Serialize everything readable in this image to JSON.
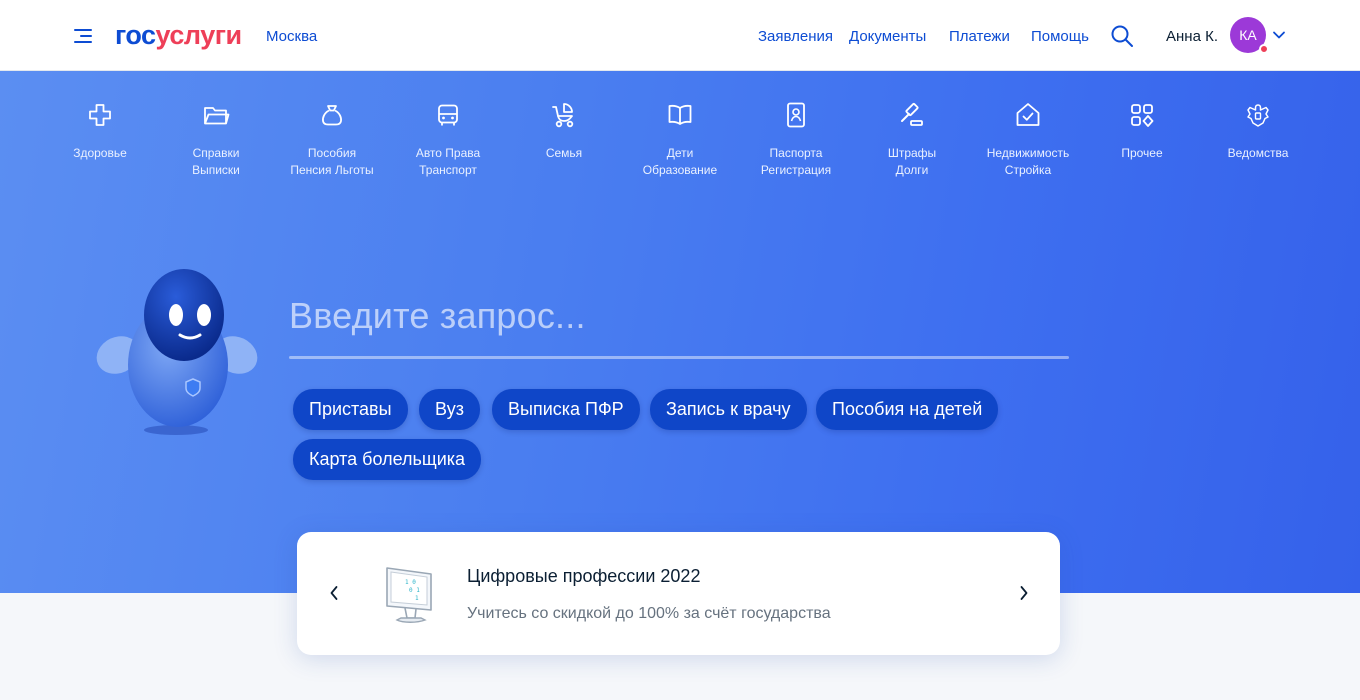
{
  "header": {
    "logo_part1": "гос",
    "logo_part2": "услуги",
    "city": "Москва",
    "nav": [
      "Заявления",
      "Документы",
      "Платежи",
      "Помощь"
    ],
    "user_name": "Анна К.",
    "avatar_initials": "КА"
  },
  "categories": [
    {
      "line1": "Здоровье",
      "line2": "",
      "icon": "health-cross-icon"
    },
    {
      "line1": "Справки",
      "line2": "Выписки",
      "icon": "folder-icon"
    },
    {
      "line1": "Пособия",
      "line2": "Пенсия Льготы",
      "icon": "money-bag-icon"
    },
    {
      "line1": "Авто Права",
      "line2": "Транспорт",
      "icon": "car-icon"
    },
    {
      "line1": "Семья",
      "line2": "",
      "icon": "stroller-icon"
    },
    {
      "line1": "Дети",
      "line2": "Образование",
      "icon": "book-icon"
    },
    {
      "line1": "Паспорта",
      "line2": "Регистрация",
      "icon": "passport-icon"
    },
    {
      "line1": "Штрафы",
      "line2": "Долги",
      "icon": "gavel-icon"
    },
    {
      "line1": "Недвижимость",
      "line2": "Стройка",
      "icon": "house-icon"
    },
    {
      "line1": "Прочее",
      "line2": "",
      "icon": "grid-icon"
    },
    {
      "line1": "Ведомства",
      "line2": "",
      "icon": "emblem-icon"
    }
  ],
  "search": {
    "placeholder": "Введите запрос..."
  },
  "chips": [
    "Приставы",
    "Вуз",
    "Выписка ПФР",
    "Запись к врачу",
    "Пособия на детей",
    "Карта болельщика"
  ],
  "promo": {
    "title": "Цифровые профессии 2022",
    "subtitle": "Учитесь со скидкой до 100% за счёт государства"
  },
  "colors": {
    "brand_blue": "#0d4cd3",
    "brand_red": "#ee3f58",
    "hero_blue": "#4a7ef0",
    "chip_blue": "#0f46c8",
    "avatar_purple": "#9c39d8"
  }
}
